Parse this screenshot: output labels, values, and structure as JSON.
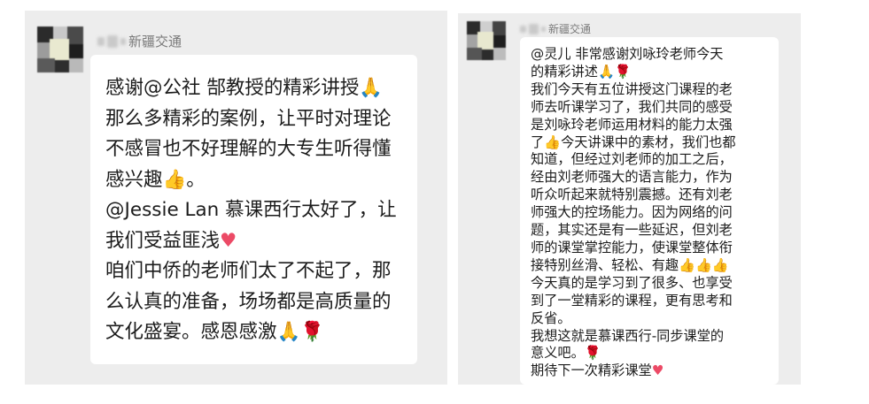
{
  "left_chat": {
    "sender_name": "新疆交通",
    "message_lines": [
      "感谢@公社  郜教授的精彩讲授",
      "那么多精彩的案例，让平时对理论",
      "不感冒也不好理解的大专生听得懂",
      "感兴趣",
      "@Jessie Lan 慕课西行太好了，让",
      "我们受益匪浅",
      "咱们中侨的老师们太了不起了，那",
      "么认真的准备，场场都是高质量的",
      "文化盛宴。感恩感激"
    ],
    "emoji": {
      "line1": "🙏",
      "line4": "👍",
      "line4_tail": "。",
      "line6": "♥",
      "line9_a": "🙏",
      "line9_b": "🌹"
    }
  },
  "right_chat": {
    "sender_name": "新疆交通",
    "message_lines": [
      "@灵儿  非常感谢刘咏玲老师今天",
      "的精彩讲述",
      "我们今天有五位讲授这门课程的老",
      "师去听课学习了，我们共同的感受",
      "是刘咏玲老师运用材料的能力太强",
      "了",
      "今天讲课中的素材，我们也都",
      "知道，但经过刘老师的加工之后，",
      "经由刘老师强大的语言能力，作为",
      "听众听起来就特别震撼。还有刘老",
      "师强大的控场能力。因为网络的问",
      "题，其实还是有一些延迟，但刘老",
      "师的课堂掌控能力，使课堂整体衔",
      "接特别丝滑、轻松、有趣",
      "今天真的是学习到了很多、也享受",
      "到了一堂精彩的课程，更有思考和",
      "反省。",
      "我想这就是慕课西行-同步课堂的",
      "意义吧。",
      "期待下一次精彩课堂"
    ],
    "emoji": {
      "pray": "🙏",
      "rose": "🌹",
      "thumb": "👍",
      "heart": "♥"
    }
  },
  "colors": {
    "panel_bg": "#ededed",
    "bubble_bg": "#ffffff",
    "text": "#1c1c1c",
    "sender_text": "#7a7a7a"
  }
}
